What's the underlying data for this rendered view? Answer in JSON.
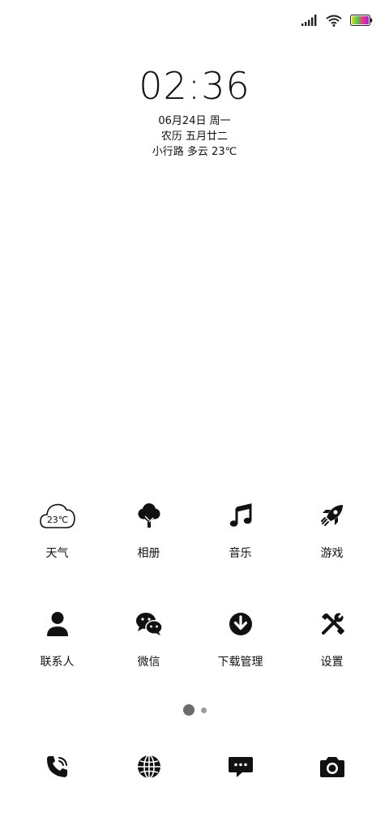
{
  "status_bar": {
    "signal_icon": "signal-bars-icon",
    "wifi_icon": "wifi-icon",
    "battery_icon": "battery-icon"
  },
  "clock": {
    "time": "02:36",
    "date": "06月24日 周一",
    "lunar": "农历 五月廿二",
    "weather": "小行路 多云 23℃"
  },
  "apps": [
    {
      "label": "天气",
      "icon": "weather-cloud-icon",
      "icon_text": "23℃"
    },
    {
      "label": "相册",
      "icon": "tree-icon"
    },
    {
      "label": "音乐",
      "icon": "music-note-icon"
    },
    {
      "label": "游戏",
      "icon": "rocket-icon"
    },
    {
      "label": "联系人",
      "icon": "person-icon"
    },
    {
      "label": "微信",
      "icon": "wechat-icon"
    },
    {
      "label": "下载管理",
      "icon": "download-icon"
    },
    {
      "label": "设置",
      "icon": "tools-icon"
    }
  ],
  "page_indicator": {
    "pages": 2,
    "current": 1
  },
  "dock": [
    {
      "icon": "phone-icon"
    },
    {
      "icon": "globe-icon"
    },
    {
      "icon": "message-icon"
    },
    {
      "icon": "camera-icon"
    }
  ]
}
